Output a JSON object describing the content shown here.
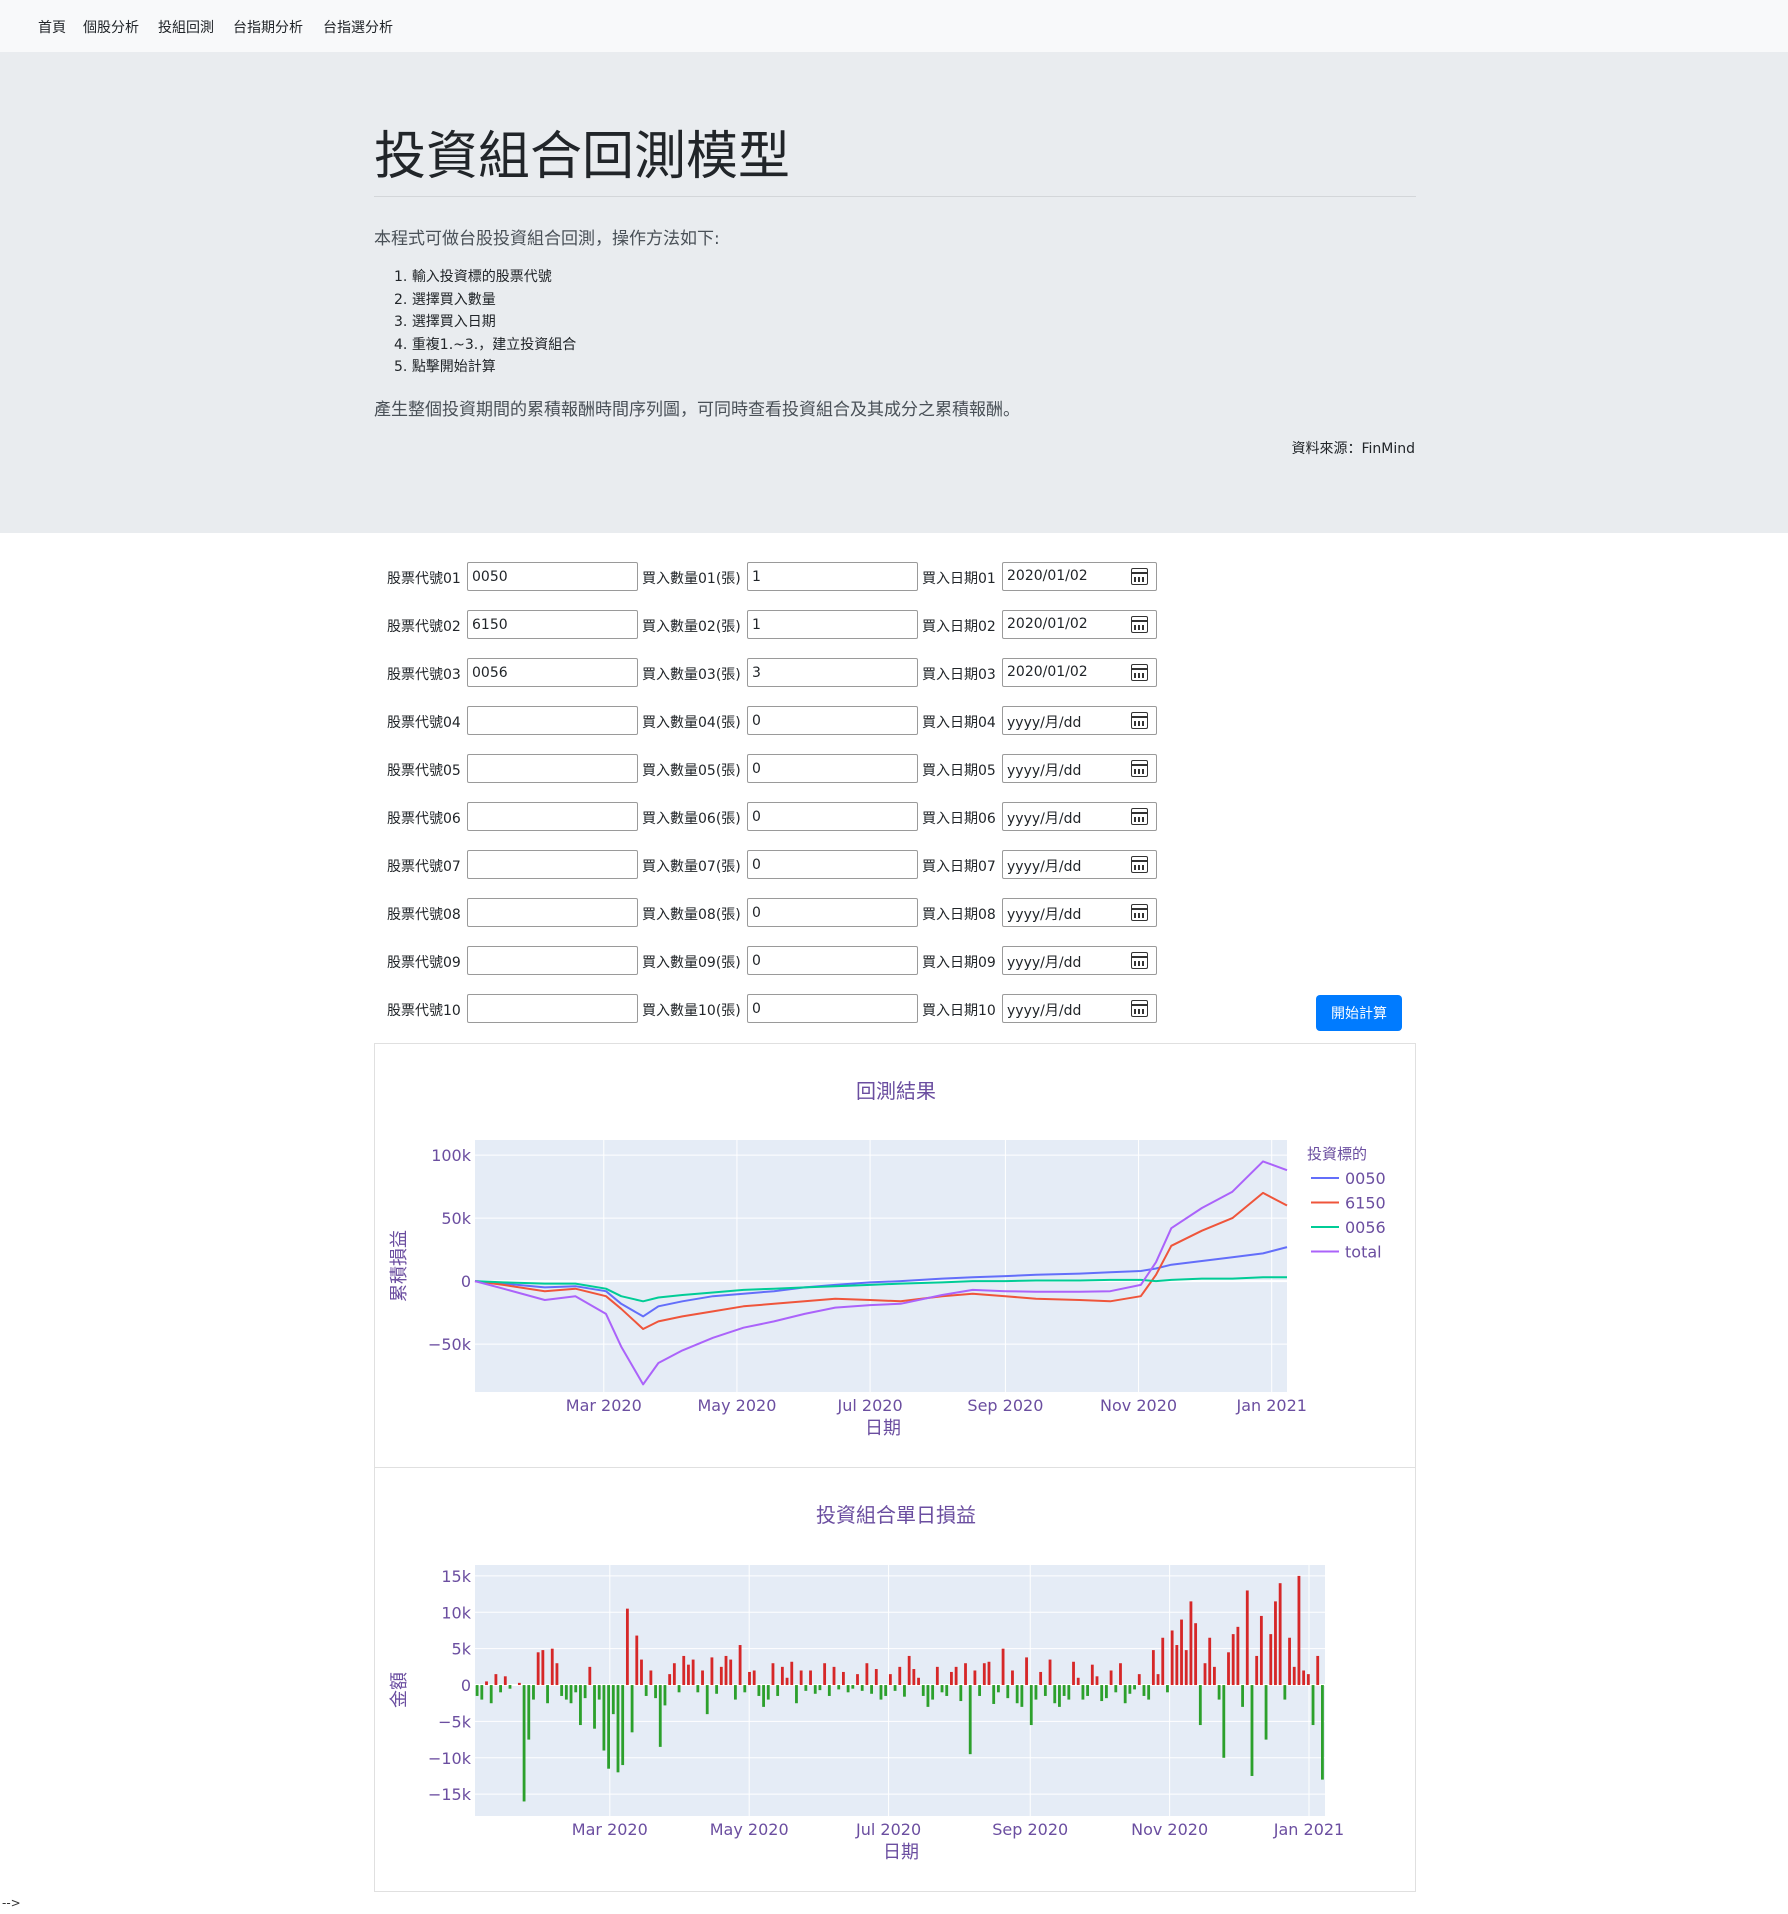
{
  "nav": {
    "items": [
      "首頁",
      "個股分析",
      "投組回測",
      "台指期分析",
      "台指選分析"
    ]
  },
  "header": {
    "title": "投資組合回測模型",
    "intro": "本程式可做台股投資組合回測，操作方法如下:",
    "steps": [
      "輸入投資標的股票代號",
      "選擇買入數量",
      "選擇買入日期",
      "重複1.~3.，建立投資組合",
      "點擊開始計算"
    ],
    "summary": "產生整個投資期間的累積報酬時間序列圖，可同時查看投資組合及其成分之累積報酬。",
    "source": "資料來源：FinMind"
  },
  "form": {
    "rows": [
      {
        "code_label": "股票代號01",
        "code": "0050",
        "qty_label": "買入數量01(張)",
        "qty": "1",
        "date_label": "買入日期01",
        "date": "2020/01/02"
      },
      {
        "code_label": "股票代號02",
        "code": "6150",
        "qty_label": "買入數量02(張)",
        "qty": "1",
        "date_label": "買入日期02",
        "date": "2020/01/02"
      },
      {
        "code_label": "股票代號03",
        "code": "0056",
        "qty_label": "買入數量03(張)",
        "qty": "3",
        "date_label": "買入日期03",
        "date": "2020/01/02"
      },
      {
        "code_label": "股票代號04",
        "code": "",
        "qty_label": "買入數量04(張)",
        "qty": "0",
        "date_label": "買入日期04",
        "date": "yyyy/月/dd"
      },
      {
        "code_label": "股票代號05",
        "code": "",
        "qty_label": "買入數量05(張)",
        "qty": "0",
        "date_label": "買入日期05",
        "date": "yyyy/月/dd"
      },
      {
        "code_label": "股票代號06",
        "code": "",
        "qty_label": "買入數量06(張)",
        "qty": "0",
        "date_label": "買入日期06",
        "date": "yyyy/月/dd"
      },
      {
        "code_label": "股票代號07",
        "code": "",
        "qty_label": "買入數量07(張)",
        "qty": "0",
        "date_label": "買入日期07",
        "date": "yyyy/月/dd"
      },
      {
        "code_label": "股票代號08",
        "code": "",
        "qty_label": "買入數量08(張)",
        "qty": "0",
        "date_label": "買入日期08",
        "date": "yyyy/月/dd"
      },
      {
        "code_label": "股票代號09",
        "code": "",
        "qty_label": "買入數量09(張)",
        "qty": "0",
        "date_label": "買入日期09",
        "date": "yyyy/月/dd"
      },
      {
        "code_label": "股票代號10",
        "code": "",
        "qty_label": "買入數量10(張)",
        "qty": "0",
        "date_label": "買入日期10",
        "date": "yyyy/月/dd"
      }
    ],
    "submit_label": "開始計算"
  },
  "chart_data": [
    {
      "type": "line",
      "title": "回測結果",
      "xlabel": "日期",
      "ylabel": "累積損益",
      "xticks": [
        "Mar 2020",
        "May 2020",
        "Jul 2020",
        "Sep 2020",
        "Nov 2020",
        "Jan 2021"
      ],
      "yticks": [
        "100k",
        "50k",
        "0",
        "−50k"
      ],
      "ylim": [
        -88000,
        112000
      ],
      "legend_title": "投資標的",
      "legend_position": "right",
      "grid": true,
      "x": [
        "2020-01-02",
        "2020-01-15",
        "2020-02-03",
        "2020-02-17",
        "2020-03-02",
        "2020-03-09",
        "2020-03-19",
        "2020-03-26",
        "2020-04-06",
        "2020-04-20",
        "2020-05-04",
        "2020-05-18",
        "2020-06-01",
        "2020-06-15",
        "2020-07-01",
        "2020-07-15",
        "2020-08-03",
        "2020-08-17",
        "2020-09-01",
        "2020-09-15",
        "2020-10-05",
        "2020-10-19",
        "2020-11-02",
        "2020-11-09",
        "2020-11-16",
        "2020-11-30",
        "2020-12-14",
        "2020-12-28",
        "2021-01-08"
      ],
      "series": [
        {
          "name": "0050",
          "color": "#636efa",
          "values": [
            0,
            -2000,
            -5000,
            -4000,
            -8000,
            -18000,
            -28000,
            -20000,
            -16000,
            -12000,
            -10000,
            -8000,
            -5000,
            -3000,
            -1000,
            0,
            2000,
            3000,
            4000,
            5000,
            6000,
            7000,
            8000,
            10000,
            13000,
            16000,
            19000,
            22000,
            27000
          ]
        },
        {
          "name": "6150",
          "color": "#ef553b",
          "values": [
            0,
            -3000,
            -8000,
            -6000,
            -12000,
            -22000,
            -38000,
            -32000,
            -28000,
            -24000,
            -20000,
            -18000,
            -16000,
            -14000,
            -15000,
            -16000,
            -12000,
            -10000,
            -12000,
            -14000,
            -15000,
            -16000,
            -12000,
            5000,
            28000,
            40000,
            50000,
            70000,
            60000
          ]
        },
        {
          "name": "0056",
          "color": "#00cc96",
          "values": [
            0,
            -1000,
            -2000,
            -2000,
            -6000,
            -12000,
            -16000,
            -13000,
            -11000,
            -9000,
            -7000,
            -6000,
            -5000,
            -4000,
            -3000,
            -2000,
            -1000,
            0,
            0,
            500,
            500,
            1000,
            1000,
            0,
            1000,
            2000,
            2000,
            3000,
            3000
          ]
        },
        {
          "name": "total",
          "color": "#ab63fa",
          "values": [
            0,
            -6000,
            -15000,
            -12000,
            -26000,
            -52000,
            -82000,
            -65000,
            -55000,
            -45000,
            -37000,
            -32000,
            -26000,
            -21000,
            -19000,
            -18000,
            -11000,
            -7000,
            -8000,
            -8500,
            -8500,
            -8000,
            -3000,
            15000,
            42000,
            58000,
            71000,
            95000,
            88000
          ]
        }
      ]
    },
    {
      "type": "bar",
      "title": "投資組合單日損益",
      "xlabel": "日期",
      "ylabel": "金額",
      "xticks": [
        "Mar 2020",
        "May 2020",
        "Jul 2020",
        "Sep 2020",
        "Nov 2020",
        "Jan 2021"
      ],
      "yticks": [
        "15k",
        "10k",
        "5k",
        "0",
        "−5k",
        "−10k",
        "−15k"
      ],
      "ylim": [
        -18000,
        16500
      ],
      "positive_color": "#d62728",
      "negative_color": "#2ca02c",
      "grid": true,
      "x_start": "2020-01-02",
      "x_end": "2021-01-08",
      "values": [
        -1500,
        -2000,
        500,
        -2500,
        1500,
        -1000,
        1200,
        -500,
        0,
        300,
        -16000,
        -7500,
        -2000,
        4500,
        4800,
        -2500,
        5000,
        3000,
        -1500,
        -2000,
        -2500,
        -1000,
        -5500,
        -1800,
        2500,
        -6000,
        -2000,
        -9000,
        -11500,
        -4000,
        -12000,
        -11000,
        10500,
        -6500,
        6800,
        3500,
        -1500,
        2000,
        -1800,
        -8500,
        -2800,
        1500,
        3000,
        -1000,
        4000,
        2800,
        3500,
        -1000,
        2000,
        -4000,
        3800,
        -1200,
        2500,
        4000,
        3500,
        -2000,
        5500,
        -1000,
        1800,
        2000,
        -1500,
        -3000,
        -2000,
        3000,
        -1500,
        2500,
        1000,
        3200,
        -2500,
        2000,
        -800,
        2000,
        -1200,
        -700,
        3000,
        -1500,
        2500,
        -600,
        1800,
        -1000,
        -500,
        1500,
        -800,
        3000,
        -1200,
        2200,
        -2000,
        -1500,
        1500,
        -800,
        2500,
        -1600,
        4000,
        2200,
        1000,
        -1500,
        -3000,
        -2000,
        2500,
        -1000,
        -1500,
        1800,
        2500,
        -2200,
        3000,
        -9500,
        2000,
        -1500,
        3000,
        3200,
        -2600,
        -1000,
        5000,
        -1800,
        2000,
        -2500,
        -3000,
        3800,
        -5500,
        -2000,
        1800,
        -1500,
        3500,
        -2500,
        -3000,
        -1500,
        -2000,
        3200,
        1000,
        -2000,
        -1500,
        2800,
        1200,
        -2200,
        -1800,
        2000,
        -1000,
        3000,
        -2500,
        -1200,
        -600,
        1500,
        -1500,
        -2000,
        4800,
        1500,
        6500,
        -1000,
        7500,
        5500,
        9000,
        4800,
        11500,
        8500,
        -5500,
        3000,
        6500,
        2500,
        -2000,
        -10000,
        4500,
        7000,
        8000,
        -3000,
        13000,
        -12500,
        4000,
        9500,
        -7500,
        7000,
        11500,
        14000,
        -2000,
        6500,
        2500,
        15000,
        2000,
        1500,
        -5500,
        4000,
        -13000
      ]
    }
  ]
}
